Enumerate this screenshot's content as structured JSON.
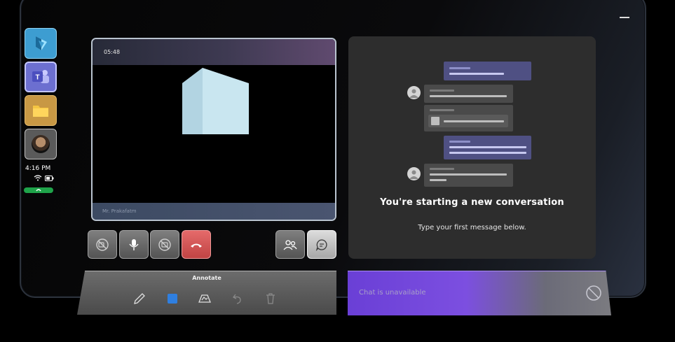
{
  "window": {
    "minimize_label": "Minimize"
  },
  "sidebar": {
    "apps": [
      {
        "name": "Dynamics 365 Guides",
        "icon": "dynamics-icon"
      },
      {
        "name": "Teams",
        "icon": "teams-icon",
        "badge": "T"
      },
      {
        "name": "Files",
        "icon": "folder-icon"
      },
      {
        "name": "Profile",
        "icon": "avatar"
      }
    ],
    "time": "4:16 PM",
    "status_icons": [
      "wifi-icon",
      "battery-icon"
    ],
    "call_indicator_icon": "phone-icon"
  },
  "video": {
    "timer": "05:48",
    "participant_name": "Mr. Prakafatm"
  },
  "call_controls": [
    {
      "name": "video-off",
      "icon": "video-off-icon"
    },
    {
      "name": "microphone",
      "icon": "microphone-icon"
    },
    {
      "name": "share-off",
      "icon": "share-off-icon"
    },
    {
      "name": "hang-up",
      "icon": "hang-up-icon"
    },
    {
      "name": "participants",
      "icon": "people-icon"
    },
    {
      "name": "chat",
      "icon": "chat-icon"
    }
  ],
  "annotate": {
    "title": "Annotate",
    "tools": [
      "pen-icon",
      "color-swatch-icon",
      "ink-tool-icon",
      "undo-icon",
      "delete-icon"
    ]
  },
  "chat": {
    "empty_title": "You're starting a new conversation",
    "empty_subtitle": "Type your first message below.",
    "input_placeholder": "Chat is unavailable",
    "input_status_icon": "unavailable-icon"
  },
  "colors": {
    "accent_purple": "#6a3fd6",
    "hangup_red": "#d65555",
    "call_green": "#1fa34a",
    "chat_bubble_me": "#4f5083"
  }
}
